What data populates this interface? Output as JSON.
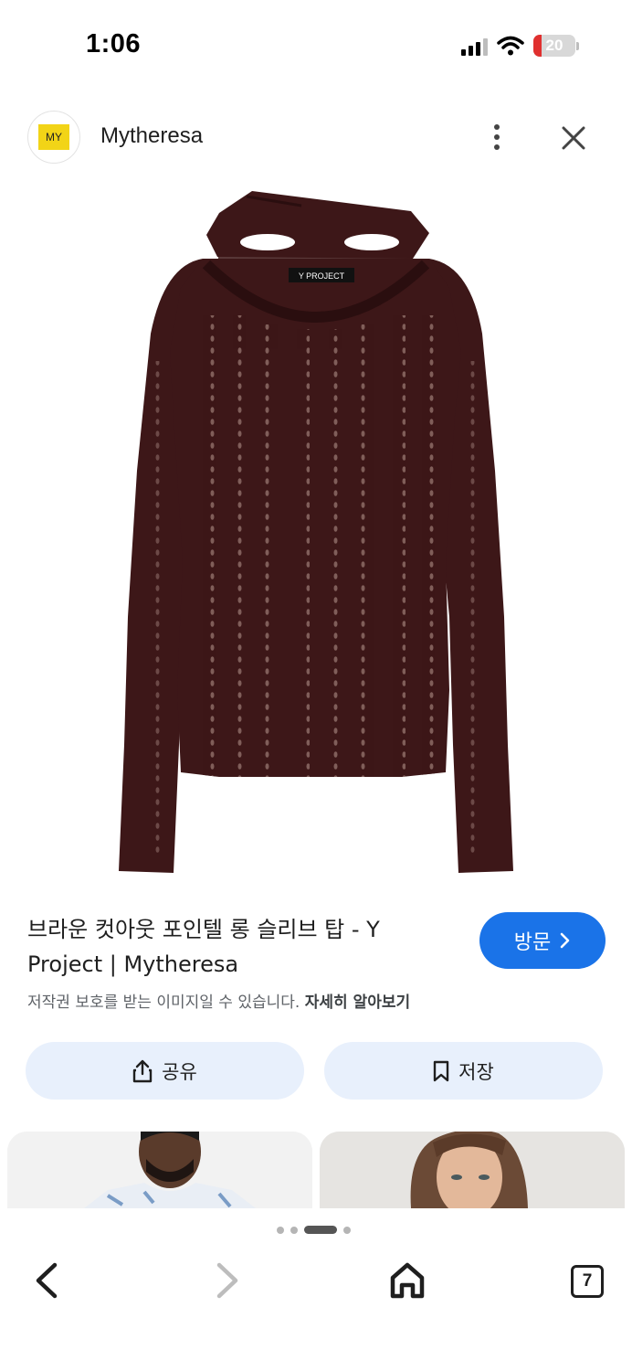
{
  "status_bar": {
    "time": "1:06",
    "battery_level": "20",
    "battery_fraction": 0.2,
    "icons": [
      "cellular-signal-icon",
      "wifi-icon",
      "battery-icon"
    ]
  },
  "header": {
    "logo_text": "MY",
    "site_name": "Mytheresa",
    "icons": [
      "more-vert-icon",
      "close-icon"
    ]
  },
  "product": {
    "image_label": "Y PROJECT",
    "title": "브라운 컷아웃 포인텔 롱 슬리브 탑 - Y Project | Mytheresa",
    "visit_label": "방문",
    "copyright_notice": "저작권 보호를 받는 이미지일 수 있습니다.",
    "learn_more": "자세히 알아보기"
  },
  "actions": {
    "share_label": "공유",
    "save_label": "저장"
  },
  "bottom_bar": {
    "tab_count": "7",
    "page_dots": 4,
    "active_dot": 2,
    "icons": [
      "back-arrow-icon",
      "forward-arrow-icon",
      "home-icon",
      "tabs-icon"
    ]
  },
  "colors": {
    "accent": "#1a73e8",
    "action_button_bg": "#e8f0fc",
    "garment": "#3d1718",
    "logo_yellow": "#f2d417",
    "battery_red": "#e0302f"
  }
}
